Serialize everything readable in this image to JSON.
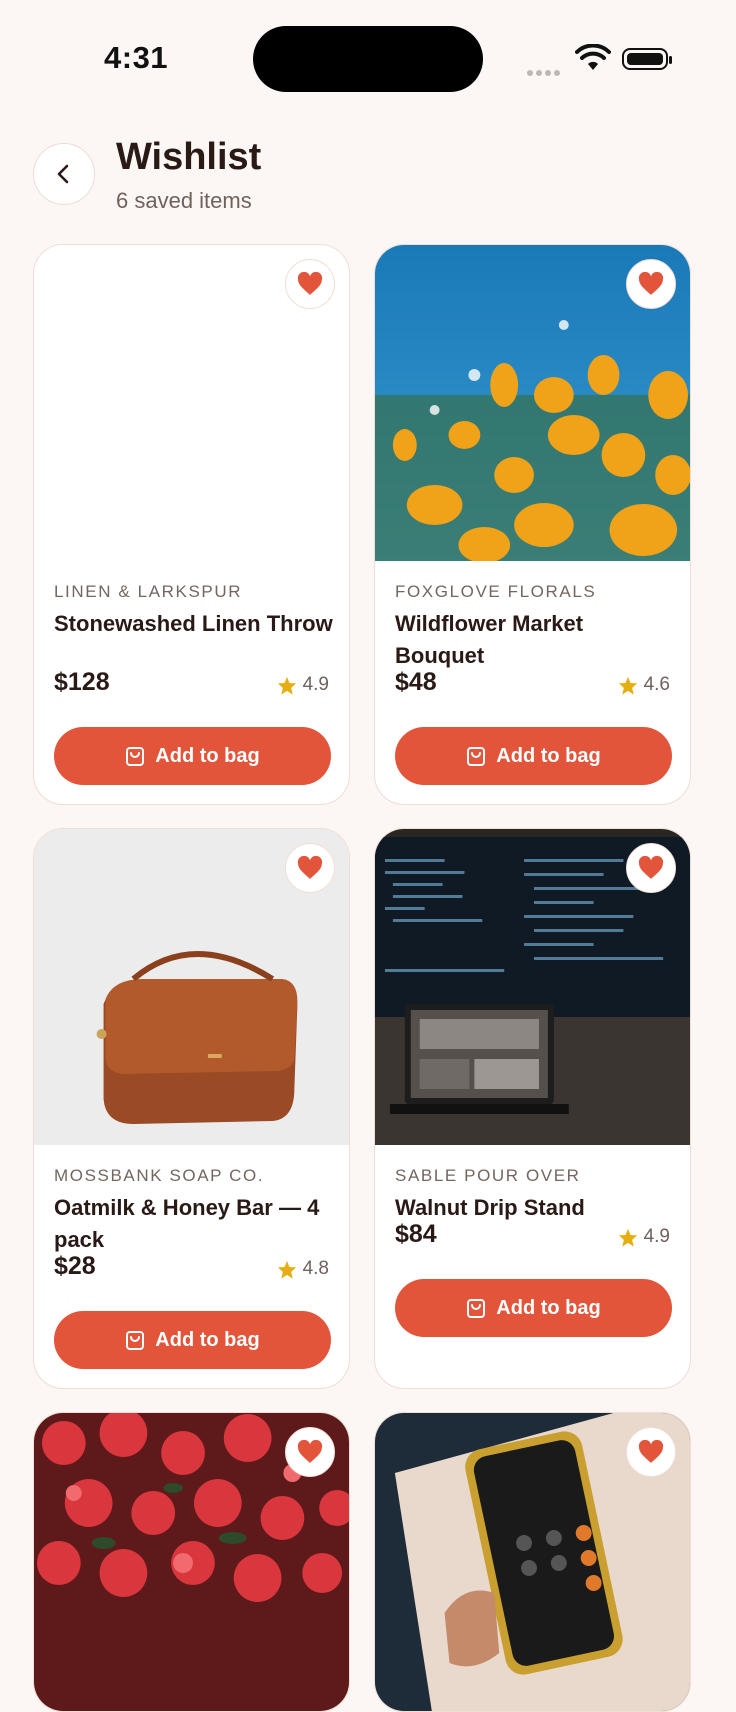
{
  "status_bar": {
    "time": "4:31"
  },
  "header": {
    "title": "Wishlist",
    "subtitle": "6 saved items"
  },
  "button_label": "Add to bag",
  "colors": {
    "accent": "#e2553a",
    "star": "#e6ae10",
    "background": "#fcf7f4"
  },
  "items": [
    {
      "brand": "LINEN & LARKSPUR",
      "name": "Stonewashed Linen Throw",
      "price": "$128",
      "rating": "4.9",
      "image": "blank"
    },
    {
      "brand": "FOXGLOVE FLORALS",
      "name": "Wildflower Market Bouquet",
      "price": "$48",
      "rating": "4.6",
      "image": "yellow-poppies"
    },
    {
      "brand": "MOSSBANK SOAP CO.",
      "name": "Oatmilk & Honey Bar — 4 pack",
      "price": "$28",
      "rating": "4.8",
      "image": "brown-leather-bag"
    },
    {
      "brand": "SABLE POUR OVER",
      "name": "Walnut Drip Stand",
      "price": "$84",
      "rating": "4.9",
      "image": "code-monitor-laptop"
    },
    {
      "image": "red-flowers"
    },
    {
      "image": "phone-calculator"
    }
  ]
}
